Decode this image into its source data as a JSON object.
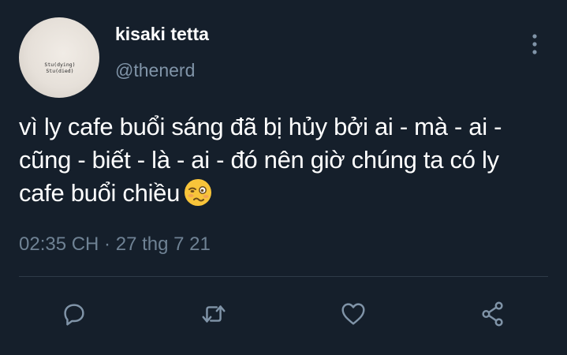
{
  "tweet": {
    "display_name": "kisaki tetta",
    "handle": "@thenerd",
    "avatar_shirt_text": [
      "Stu(dying)",
      "Stu(died)"
    ],
    "text": "vì ly cafe buổi sáng đã bị hủy bởi ai - mà - ai - cũng - biết - là - ai - đó nên giờ chúng ta có ly cafe buổi chiều",
    "emoji": "woozy-face",
    "timestamp": "02:35 CH · 27 thg 7 21"
  },
  "actions": [
    {
      "name": "reply",
      "icon": "reply-icon"
    },
    {
      "name": "retweet",
      "icon": "retweet-icon"
    },
    {
      "name": "like",
      "icon": "heart-icon"
    },
    {
      "name": "share",
      "icon": "share-icon"
    }
  ],
  "colors": {
    "background": "#151f2b",
    "primary_text": "#ffffff",
    "secondary_text": "#8094a8",
    "icon": "#8094a8",
    "divider": "#2e3b48"
  }
}
